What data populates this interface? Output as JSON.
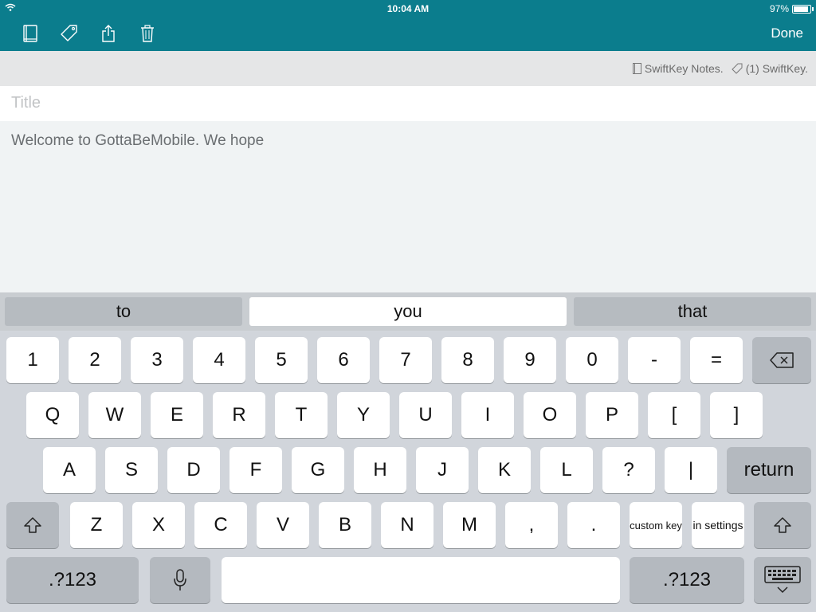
{
  "status": {
    "time": "10:04 AM",
    "battery": "97%",
    "battery_level": 0.97
  },
  "toolbar": {
    "icons": [
      "notebook-icon",
      "tag-icon",
      "share-icon",
      "trash-icon"
    ],
    "done_label": "Done",
    "color": "#0b7d8d"
  },
  "info": {
    "notebook": "SwiftKey Notes.",
    "tags": "(1) SwiftKey."
  },
  "note": {
    "title_placeholder": "Title",
    "body": "Welcome to GottaBeMobile. We hope"
  },
  "predictions": [
    "to",
    "you",
    "that"
  ],
  "keyboard": {
    "row1": [
      "1",
      "2",
      "3",
      "4",
      "5",
      "6",
      "7",
      "8",
      "9",
      "0",
      "-",
      "="
    ],
    "row2": [
      "Q",
      "W",
      "E",
      "R",
      "T",
      "Y",
      "U",
      "I",
      "O",
      "P",
      "[",
      "]"
    ],
    "row3": [
      "A",
      "S",
      "D",
      "F",
      "G",
      "H",
      "J",
      "K",
      "L",
      "?",
      "|"
    ],
    "return_label": "return",
    "row4": [
      "Z",
      "X",
      "C",
      "V",
      "B",
      "N",
      "M",
      ",",
      "."
    ],
    "custom_key": "custom key",
    "in_settings": "in settings",
    "numbers_label": ".?123"
  }
}
